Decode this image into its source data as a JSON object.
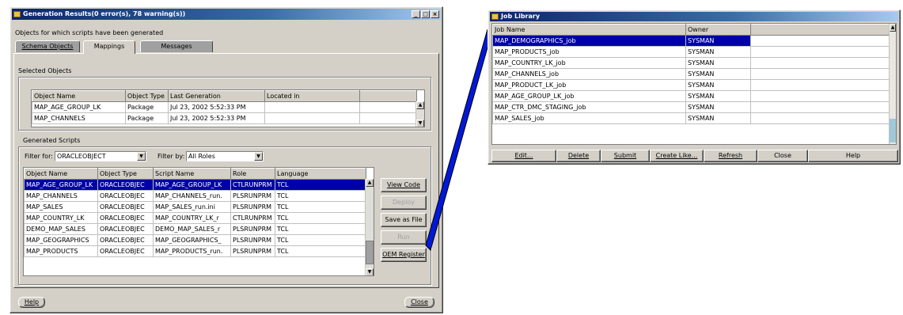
{
  "gen_dialog": {
    "title": "Generation Results(0 error(s), 78 warning(s))",
    "intro": "Objects for which scripts have been generated",
    "tabs": [
      "Schema Objects",
      "Mappings",
      "Messages"
    ],
    "selected_objects_label": "Selected Objects",
    "selected_columns": [
      "Object Name",
      "Object Type",
      "Last Generation",
      "Located in",
      ""
    ],
    "selected_rows": [
      [
        "MAP_AGE_GROUP_LK",
        "Package",
        "Jul 23, 2002 5:52:33 PM",
        "",
        ""
      ],
      [
        "MAP_CHANNELS",
        "Package",
        "Jul 23, 2002 5:52:33 PM",
        "",
        ""
      ]
    ],
    "generated_scripts_label": "Generated Scripts",
    "filter_for_label": "Filter for:",
    "filter_for_value": "ORACLEOBJECT",
    "filter_by_label": "Filter by:",
    "filter_by_value": "All Roles",
    "script_columns": [
      "Object Name",
      "Object Type",
      "Script Name",
      "Role",
      "Language"
    ],
    "script_rows": [
      [
        "MAP_AGE_GROUP_LK",
        "ORACLEOBJEC",
        "MAP_AGE_GROUP_LK",
        "CTLRUNPRM",
        "TCL"
      ],
      [
        "MAP_CHANNELS",
        "ORACLEOBJEC",
        "MAP_CHANNELS_run.",
        "PLSRUNPRM",
        "TCL"
      ],
      [
        "MAP_SALES",
        "ORACLEOBJEC",
        "MAP_SALES_run.ini",
        "PLSRUNPRM",
        "TCL"
      ],
      [
        "MAP_COUNTRY_LK",
        "ORACLEOBJEC",
        "MAP_COUNTRY_LK_r",
        "CTLRUNPRM",
        "TCL"
      ],
      [
        "DEMO_MAP_SALES",
        "ORACLEOBJEC",
        "DEMO_MAP_SALES_r",
        "PLSRUNPRM",
        "TCL"
      ],
      [
        "MAP_GEOGRAPHICS",
        "ORACLEOBJEC",
        "MAP_GEOGRAPHICS_",
        "PLSRUNPRM",
        "TCL"
      ],
      [
        "MAP_PRODUCTS",
        "ORACLEOBJEC",
        "MAP_PRODUCTS_run.",
        "PLSRUNPRM",
        "TCL"
      ]
    ],
    "side_buttons": [
      "View Code",
      "Deploy",
      "Save as File",
      "Run",
      "OEM Register"
    ],
    "help_label": "Help",
    "close_label": "Close"
  },
  "job_library": {
    "title": "Job Library",
    "columns": [
      "Job Name",
      "Owner"
    ],
    "rows": [
      [
        "MAP_DEMOGRAPHICS_job",
        "SYSMAN"
      ],
      [
        "MAP_PRODUCTS_job",
        "SYSMAN"
      ],
      [
        "MAP_COUNTRY_LK_job",
        "SYSMAN"
      ],
      [
        "MAP_CHANNELS_job",
        "SYSMAN"
      ],
      [
        "MAP_PRODUCT_LK_job",
        "SYSMAN"
      ],
      [
        "MAP_AGE_GROUP_LK_job",
        "SYSMAN"
      ],
      [
        "MAP_CTR_DMC_STAGING_job",
        "SYSMAN"
      ],
      [
        "MAP_SALES_job",
        "SYSMAN"
      ]
    ],
    "buttons": [
      "Edit...",
      "Delete",
      "Submit",
      "Create Like...",
      "Refresh",
      "Close",
      "Help"
    ]
  },
  "colors": {
    "selection": "#0000a8",
    "callout": "#0018d8",
    "titlebar": "#0a246a"
  }
}
